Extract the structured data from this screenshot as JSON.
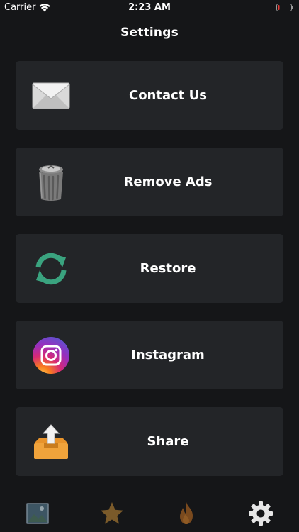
{
  "status_bar": {
    "carrier": "Carrier",
    "time": "2:23 AM",
    "battery_color": "#e53935"
  },
  "nav": {
    "title": "Settings"
  },
  "settings": {
    "items": [
      {
        "label": "Contact Us",
        "icon": "envelope-icon"
      },
      {
        "label": "Remove Ads",
        "icon": "trash-can-icon"
      },
      {
        "label": "Restore",
        "icon": "refresh-icon"
      },
      {
        "label": "Instagram",
        "icon": "instagram-icon"
      },
      {
        "label": "Share",
        "icon": "share-tray-icon"
      }
    ]
  },
  "tab_bar": {
    "tabs": [
      {
        "icon": "gallery-icon",
        "active": false
      },
      {
        "icon": "star-icon",
        "active": false
      },
      {
        "icon": "fire-icon",
        "active": false
      },
      {
        "icon": "gear-icon",
        "active": true
      }
    ]
  },
  "colors": {
    "background": "#151618",
    "row_background": "#232528",
    "accent_green": "#3aa37f",
    "share_orange": "#f0a33b"
  }
}
